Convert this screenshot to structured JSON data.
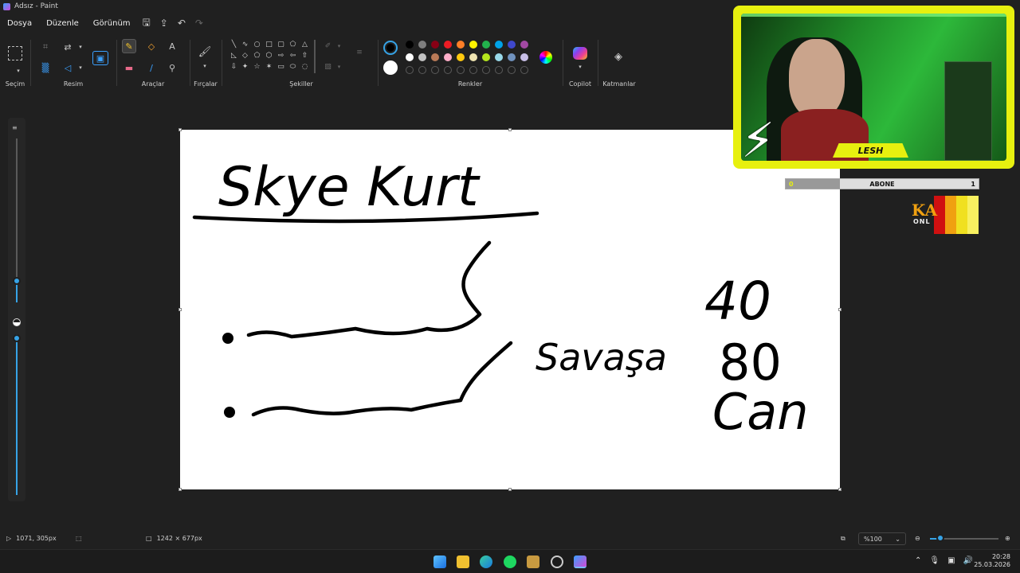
{
  "window": {
    "title": "Adsız - Paint"
  },
  "menu": {
    "file": "Dosya",
    "edit": "Düzenle",
    "view": "Görünüm"
  },
  "ribbon": {
    "selection": "Seçim",
    "image": "Resim",
    "tools": "Araçlar",
    "brushes": "Fırçalar",
    "shapes": "Şekiller",
    "colors": "Renkler",
    "copilot": "Copilot",
    "layers": "Katmanlar"
  },
  "palette": {
    "current_primary": "#000000",
    "current_secondary": "#ffffff",
    "row1": [
      "#000000",
      "#7f7f7f",
      "#880015",
      "#ed1c24",
      "#ff7f27",
      "#fff200",
      "#22b14c",
      "#00a2e8",
      "#3f48cc",
      "#a349a4"
    ],
    "row2": [
      "#ffffff",
      "#c3c3c3",
      "#b97a57",
      "#ffaec9",
      "#ffc90e",
      "#efe4b0",
      "#b5e61d",
      "#99d9ea",
      "#7092be",
      "#c8bfe7"
    ],
    "custom_slots": 10
  },
  "canvas": {
    "title_text": "Skye Kurt",
    "word_text": "Savaşa",
    "numbers": [
      "40",
      "80",
      "Can"
    ]
  },
  "stream_overlay": {
    "streamer_name": "LESH",
    "sub_goal_label": "ABONE",
    "sub_goal_current": "0",
    "sub_goal_target": "1",
    "sub_goal_progress": 0.0,
    "logo_text": "KA",
    "logo_subtext": "ONL"
  },
  "status": {
    "cursor_position": "1071, 305px",
    "canvas_size": "1242 × 677px",
    "zoom": "%100"
  },
  "taskbar": {
    "time": "20:28",
    "date": "25.03.2026"
  }
}
